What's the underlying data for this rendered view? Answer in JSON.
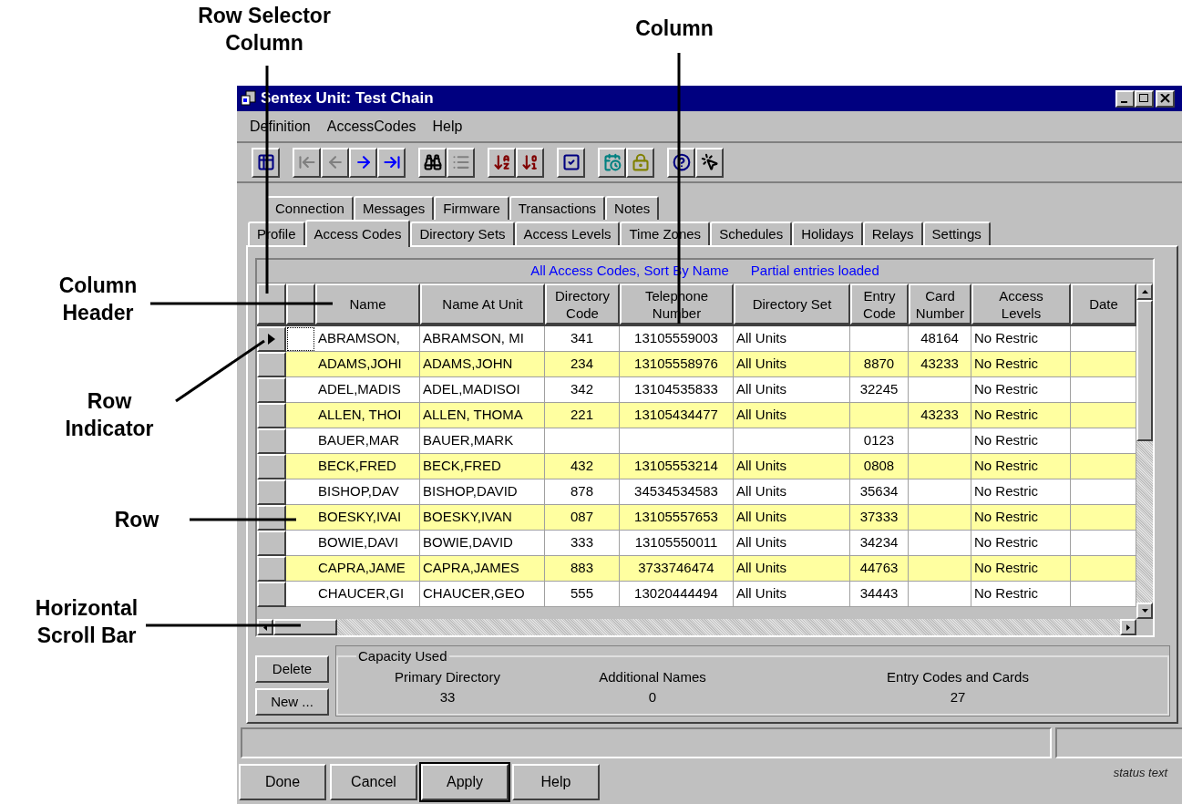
{
  "annotations": [
    {
      "text": "Row Selector Column"
    },
    {
      "text": "Column"
    },
    {
      "text": "Column Header"
    },
    {
      "text": "Row Indicator"
    },
    {
      "text": "Row"
    },
    {
      "text": "Horizontal Scroll Bar"
    }
  ],
  "window": {
    "title": "Sentex Unit: Test Chain"
  },
  "menu": [
    "Definition",
    "AccessCodes",
    "Help"
  ],
  "toolbar_buttons": [
    {
      "disabled": false
    },
    {
      "disabled": true
    },
    {
      "disabled": true
    },
    {
      "disabled": false
    },
    {
      "disabled": false
    },
    {
      "disabled": false
    },
    {
      "disabled": true
    },
    {
      "disabled": false
    },
    {
      "disabled": false
    },
    {
      "disabled": false
    },
    {
      "disabled": false
    },
    {
      "disabled": false
    },
    {
      "disabled": false
    },
    {
      "disabled": false
    }
  ],
  "tabs_back": [
    {
      "label": "Connection",
      "selected": false
    },
    {
      "label": "Messages",
      "selected": false
    },
    {
      "label": "Firmware",
      "selected": false
    },
    {
      "label": "Transactions",
      "selected": false
    },
    {
      "label": "Notes",
      "selected": false
    }
  ],
  "tabs_front": [
    {
      "label": "Profile",
      "selected": false
    },
    {
      "label": "Access Codes",
      "selected": true
    },
    {
      "label": "Directory Sets",
      "selected": false
    },
    {
      "label": "Access Levels",
      "selected": false
    },
    {
      "label": "Time Zones",
      "selected": false
    },
    {
      "label": "Schedules",
      "selected": false
    },
    {
      "label": "Holidays",
      "selected": false
    },
    {
      "label": "Relays",
      "selected": false
    },
    {
      "label": "Settings",
      "selected": false
    }
  ],
  "grid": {
    "caption": [
      "All Access Codes, Sort By Name",
      "Partial entries loaded"
    ],
    "columns": [
      "Name",
      "Name At Unit",
      "Directory\nCode",
      "Telephone\nNumber",
      "Directory Set",
      "Entry\nCode",
      "Card\nNumber",
      "Access\nLevels",
      "Date"
    ],
    "rows": [
      {
        "current": true,
        "shaded": false,
        "cells": [
          "ABRAMSON,",
          "ABRAMSON, MI",
          "341",
          "13105559003",
          "All Units",
          null,
          "48164",
          "No Restric",
          null
        ]
      },
      {
        "current": false,
        "shaded": true,
        "cells": [
          "ADAMS,JOHI",
          "ADAMS,JOHN",
          "234",
          "13105558976",
          "All Units",
          "8870",
          "43233",
          "No Restric",
          null
        ]
      },
      {
        "current": false,
        "shaded": false,
        "cells": [
          "ADEL,MADIS",
          "ADEL,MADISOI",
          "342",
          "13104535833",
          "All Units",
          "32245",
          null,
          "No Restric",
          null
        ]
      },
      {
        "current": false,
        "shaded": true,
        "cells": [
          "ALLEN, THOI",
          "ALLEN, THOMA",
          "221",
          "13105434477",
          "All Units",
          null,
          "43233",
          "No Restric",
          null
        ]
      },
      {
        "current": false,
        "shaded": false,
        "cells": [
          "BAUER,MAR",
          "BAUER,MARK",
          null,
          null,
          null,
          "0123",
          null,
          "No Restric",
          null
        ]
      },
      {
        "current": false,
        "shaded": true,
        "cells": [
          "BECK,FRED",
          "BECK,FRED",
          "432",
          "13105553214",
          "All Units",
          "0808",
          null,
          "No Restric",
          null
        ]
      },
      {
        "current": false,
        "shaded": false,
        "cells": [
          "BISHOP,DAV",
          "BISHOP,DAVID",
          "878",
          "34534534583",
          "All Units",
          "35634",
          null,
          "No Restric",
          null
        ]
      },
      {
        "current": false,
        "shaded": true,
        "cells": [
          "BOESKY,IVAI",
          "BOESKY,IVAN",
          "087",
          "13105557653",
          "All Units",
          "37333",
          null,
          "No Restric",
          null
        ]
      },
      {
        "current": false,
        "shaded": false,
        "cells": [
          "BOWIE,DAVI",
          "BOWIE,DAVID",
          "333",
          "13105550011",
          "All Units",
          "34234",
          null,
          "No Restric",
          null
        ]
      },
      {
        "current": false,
        "shaded": true,
        "cells": [
          "CAPRA,JAME",
          "CAPRA,JAMES",
          "883",
          "3733746474",
          "All Units",
          "44763",
          null,
          "No Restric",
          null
        ]
      },
      {
        "current": false,
        "shaded": false,
        "cells": [
          "CHAUCER,GI",
          "CHAUCER,GEO",
          "555",
          "13020444494",
          "All Units",
          "34443",
          null,
          "No Restric",
          null
        ]
      }
    ]
  },
  "side_buttons": [
    "Delete",
    "New ..."
  ],
  "capacity": {
    "title": "Capacity Used",
    "stats": [
      {
        "label": "Primary Directory",
        "value": "33"
      },
      {
        "label": "Additional Names",
        "value": "0"
      },
      {
        "label": "Entry Codes and Cards",
        "value": "27"
      }
    ]
  },
  "buttons": [
    {
      "label": "Done",
      "default": false
    },
    {
      "label": "Cancel",
      "default": false
    },
    {
      "label": "Apply",
      "default": true
    },
    {
      "label": "Help",
      "default": false
    }
  ],
  "status_text": "status text"
}
